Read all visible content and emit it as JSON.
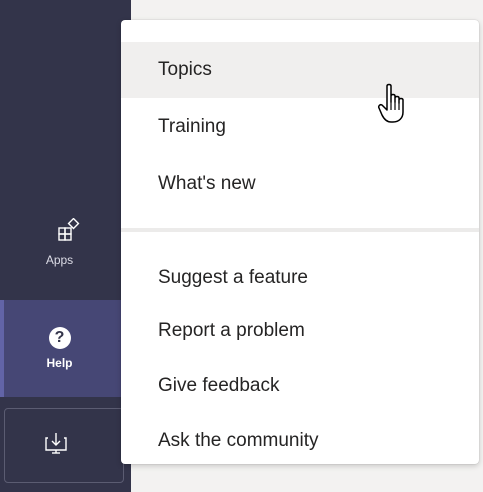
{
  "rail": {
    "apps_label": "Apps",
    "help_label": "Help",
    "help_icon_glyph": "?"
  },
  "menu": {
    "items": [
      {
        "label": "Topics"
      },
      {
        "label": "Training"
      },
      {
        "label": "What's new"
      },
      {
        "label": "Suggest a feature"
      },
      {
        "label": "Report a problem"
      },
      {
        "label": "Give feedback"
      },
      {
        "label": "Ask the community"
      }
    ],
    "hovered_item": "Topics"
  },
  "colors": {
    "rail_bg": "#33344a",
    "rail_active_bg": "#464775",
    "accent": "#6264a7",
    "menu_bg": "#ffffff",
    "hover_bg": "#f0efee"
  },
  "icons": {
    "apps": "apps-icon",
    "help": "help-icon",
    "download": "download-icon",
    "cursor": "hand-pointer-cursor-icon"
  }
}
